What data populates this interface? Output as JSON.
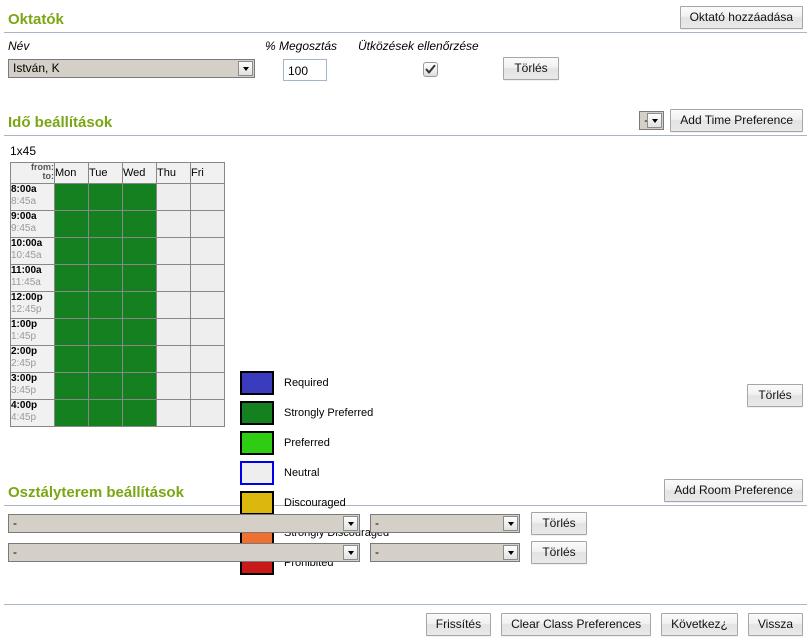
{
  "instructors": {
    "title": "Oktatók",
    "add_button": "Oktató hozzáadása",
    "labels": {
      "name": "Név",
      "share": "% Megosztás",
      "conflicts": "Ütközések ellenőrzése"
    },
    "row": {
      "name_value": "István, K",
      "share_value": "100",
      "conflicts_checked": true,
      "delete_button": "Törlés"
    }
  },
  "time_prefs": {
    "title": "Idő beállítások",
    "pattern_select_value": "-",
    "add_button": "Add Time Preference",
    "pattern_label": "1x45",
    "grid": {
      "corner_from": "from:",
      "corner_to": "to:",
      "days": [
        "Mon",
        "Tue",
        "Wed",
        "Thu",
        "Fri"
      ],
      "rows": [
        {
          "from": "8:00a",
          "to": "8:45a",
          "cells": [
            "strongly_preferred",
            "strongly_preferred",
            "strongly_preferred",
            "neutral",
            "neutral"
          ]
        },
        {
          "from": "9:00a",
          "to": "9:45a",
          "cells": [
            "strongly_preferred",
            "strongly_preferred",
            "strongly_preferred",
            "neutral",
            "neutral"
          ]
        },
        {
          "from": "10:00a",
          "to": "10:45a",
          "cells": [
            "strongly_preferred",
            "strongly_preferred",
            "strongly_preferred",
            "neutral",
            "neutral"
          ]
        },
        {
          "from": "11:00a",
          "to": "11:45a",
          "cells": [
            "strongly_preferred",
            "strongly_preferred",
            "strongly_preferred",
            "neutral",
            "neutral"
          ]
        },
        {
          "from": "12:00p",
          "to": "12:45p",
          "cells": [
            "strongly_preferred",
            "strongly_preferred",
            "strongly_preferred",
            "neutral",
            "neutral"
          ]
        },
        {
          "from": "1:00p",
          "to": "1:45p",
          "cells": [
            "strongly_preferred",
            "strongly_preferred",
            "strongly_preferred",
            "neutral",
            "neutral"
          ]
        },
        {
          "from": "2:00p",
          "to": "2:45p",
          "cells": [
            "strongly_preferred",
            "strongly_preferred",
            "strongly_preferred",
            "neutral",
            "neutral"
          ]
        },
        {
          "from": "3:00p",
          "to": "3:45p",
          "cells": [
            "strongly_preferred",
            "strongly_preferred",
            "strongly_preferred",
            "neutral",
            "neutral"
          ]
        },
        {
          "from": "4:00p",
          "to": "4:45p",
          "cells": [
            "strongly_preferred",
            "strongly_preferred",
            "strongly_preferred",
            "neutral",
            "neutral"
          ]
        }
      ]
    },
    "legend": [
      {
        "key": "required",
        "label": "Required",
        "color": "#3b3bbd"
      },
      {
        "key": "strongly_preferred",
        "label": "Strongly Preferred",
        "color": "#14801f"
      },
      {
        "key": "preferred",
        "label": "Preferred",
        "color": "#2fcc14"
      },
      {
        "key": "neutral",
        "label": "Neutral",
        "color": "#eeeeee"
      },
      {
        "key": "discouraged",
        "label": "Discouraged",
        "color": "#dbb80d"
      },
      {
        "key": "strongly_discouraged",
        "label": "Strongly Discouraged",
        "color": "#f07030"
      },
      {
        "key": "prohibited",
        "label": "Prohibited",
        "color": "#c81818"
      }
    ],
    "delete_button": "Törlés"
  },
  "room_prefs": {
    "title": "Osztályterem beállítások",
    "add_button": "Add Room Preference",
    "rows": [
      {
        "room_value": "-",
        "pref_value": "-",
        "delete_button": "Törlés"
      },
      {
        "room_value": "-",
        "pref_value": "-",
        "delete_button": "Törlés"
      }
    ]
  },
  "footer": {
    "buttons": [
      "Frissítés",
      "Clear Class Preferences",
      "Következ¿",
      "Vissza"
    ]
  },
  "colors": {
    "header_green": "#7ba614",
    "rule": "#a8b5c4",
    "neutral_cell": "#eeeeee"
  }
}
